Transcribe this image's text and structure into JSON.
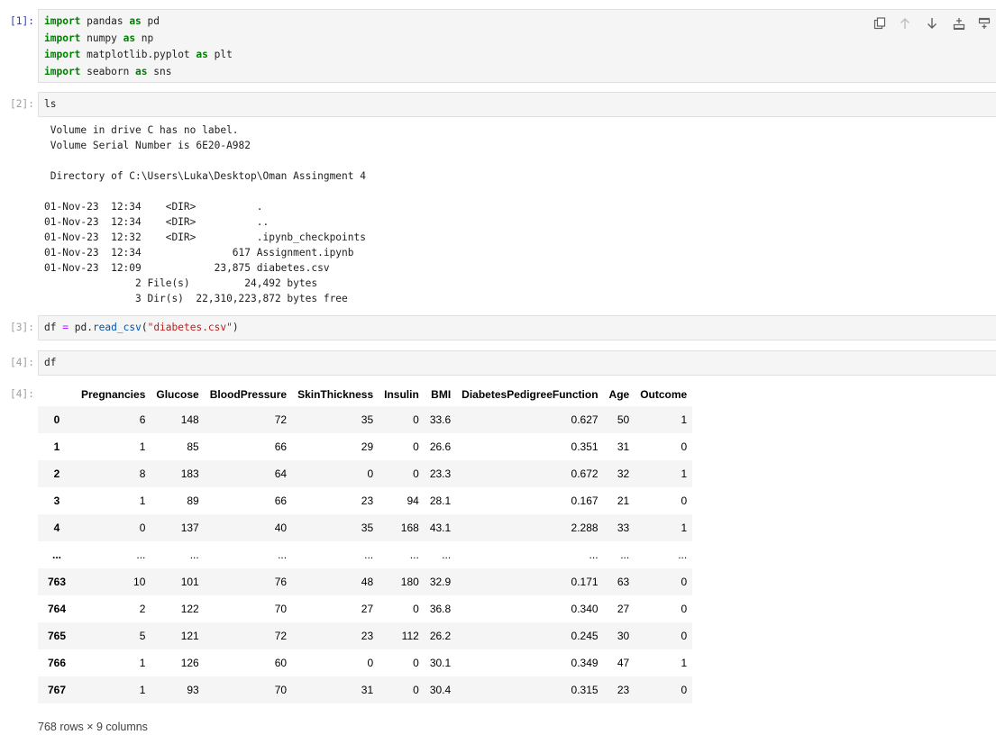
{
  "cells": [
    {
      "prompt": "[1]:",
      "lines": [
        [
          {
            "t": "import",
            "c": "kw"
          },
          {
            "t": " pandas "
          },
          {
            "t": "as",
            "c": "kw"
          },
          {
            "t": " pd"
          }
        ],
        [
          {
            "t": "import",
            "c": "kw"
          },
          {
            "t": " numpy "
          },
          {
            "t": "as",
            "c": "kw"
          },
          {
            "t": " np"
          }
        ],
        [
          {
            "t": "import",
            "c": "kw"
          },
          {
            "t": " matplotlib.pyplot "
          },
          {
            "t": "as",
            "c": "kw"
          },
          {
            "t": " plt"
          }
        ],
        [
          {
            "t": "import",
            "c": "kw"
          },
          {
            "t": " seaborn "
          },
          {
            "t": "as",
            "c": "kw"
          },
          {
            "t": " sns"
          }
        ]
      ]
    },
    {
      "prompt": "[2]:",
      "lines": [
        [
          {
            "t": "ls"
          }
        ]
      ]
    },
    {
      "prompt": "[3]:",
      "lines": [
        [
          {
            "t": "df "
          },
          {
            "t": "=",
            "c": "op"
          },
          {
            "t": " pd"
          },
          {
            "t": "."
          },
          {
            "t": "read_csv",
            "c": "fn"
          },
          {
            "t": "("
          },
          {
            "t": "\"diabetes.csv\"",
            "c": "str"
          },
          {
            "t": ")"
          }
        ]
      ]
    },
    {
      "prompt": "[4]:",
      "lines": [
        [
          {
            "t": "df"
          }
        ]
      ]
    }
  ],
  "toolbar": [
    "duplicate-icon",
    "move-up-icon",
    "move-down-icon",
    "insert-below-icon",
    "insert-above-icon"
  ],
  "ls_output": [
    " Volume in drive C has no label.",
    " Volume Serial Number is 6E20-A982",
    "",
    " Directory of C:\\Users\\Luka\\Desktop\\Oman Assingment 4",
    "",
    "01-Nov-23  12:34    <DIR>          .",
    "01-Nov-23  12:34    <DIR>          ..",
    "01-Nov-23  12:32    <DIR>          .ipynb_checkpoints",
    "01-Nov-23  12:34               617 Assignment.ipynb",
    "01-Nov-23  12:09            23,875 diabetes.csv",
    "               2 File(s)         24,492 bytes",
    "               3 Dir(s)  22,310,223,872 bytes free"
  ],
  "output_prompt": "[4]:",
  "dataframe": {
    "columns": [
      "Pregnancies",
      "Glucose",
      "BloodPressure",
      "SkinThickness",
      "Insulin",
      "BMI",
      "DiabetesPedigreeFunction",
      "Age",
      "Outcome"
    ],
    "rows": [
      {
        "index": "0",
        "values": [
          "6",
          "148",
          "72",
          "35",
          "0",
          "33.6",
          "0.627",
          "50",
          "1"
        ]
      },
      {
        "index": "1",
        "values": [
          "1",
          "85",
          "66",
          "29",
          "0",
          "26.6",
          "0.351",
          "31",
          "0"
        ]
      },
      {
        "index": "2",
        "values": [
          "8",
          "183",
          "64",
          "0",
          "0",
          "23.3",
          "0.672",
          "32",
          "1"
        ]
      },
      {
        "index": "3",
        "values": [
          "1",
          "89",
          "66",
          "23",
          "94",
          "28.1",
          "0.167",
          "21",
          "0"
        ]
      },
      {
        "index": "4",
        "values": [
          "0",
          "137",
          "40",
          "35",
          "168",
          "43.1",
          "2.288",
          "33",
          "1"
        ]
      },
      {
        "index": "...",
        "values": [
          "...",
          "...",
          "...",
          "...",
          "...",
          "...",
          "...",
          "...",
          "..."
        ]
      },
      {
        "index": "763",
        "values": [
          "10",
          "101",
          "76",
          "48",
          "180",
          "32.9",
          "0.171",
          "63",
          "0"
        ]
      },
      {
        "index": "764",
        "values": [
          "2",
          "122",
          "70",
          "27",
          "0",
          "36.8",
          "0.340",
          "27",
          "0"
        ]
      },
      {
        "index": "765",
        "values": [
          "5",
          "121",
          "72",
          "23",
          "112",
          "26.2",
          "0.245",
          "30",
          "0"
        ]
      },
      {
        "index": "766",
        "values": [
          "1",
          "126",
          "60",
          "0",
          "0",
          "30.1",
          "0.349",
          "47",
          "1"
        ]
      },
      {
        "index": "767",
        "values": [
          "1",
          "93",
          "70",
          "31",
          "0",
          "30.4",
          "0.315",
          "23",
          "0"
        ]
      }
    ],
    "shape_note": "768 rows × 9 columns"
  },
  "colors": {
    "prompt_active": "#303f9f",
    "prompt_inactive": "#9e9e9e",
    "cell_bg": "#f5f5f5",
    "keyword": "#008000"
  }
}
